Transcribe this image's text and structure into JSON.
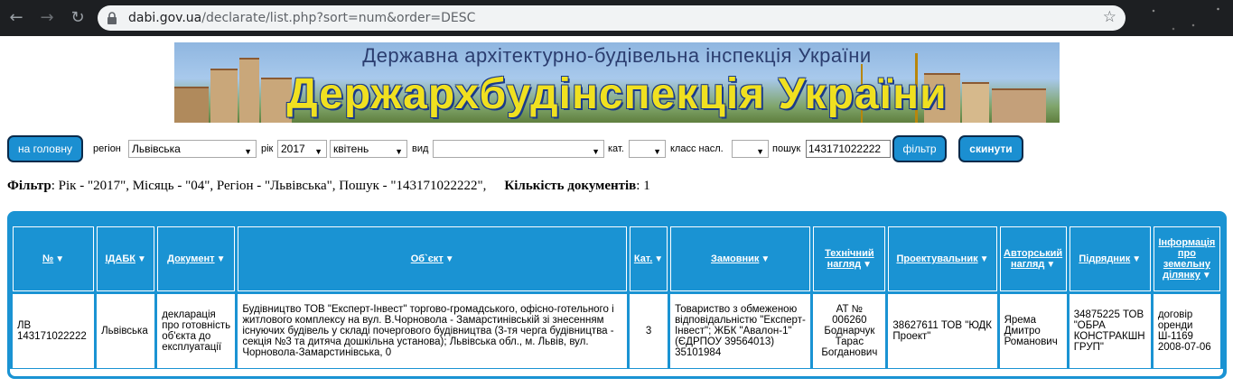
{
  "browser": {
    "url_host": "dabi.gov.ua",
    "url_path": "/declarate/list.php?sort=num&order=DESC",
    "back_glyph": "←",
    "forward_glyph": "→",
    "reload_glyph": "↻",
    "star_glyph": "☆"
  },
  "banner": {
    "subtitle": "Державна архітектурно-будівельна інспекція України",
    "title": "Держархбудінспекція України"
  },
  "filters": {
    "home_button": "на головну",
    "region_label": "регіон",
    "region_value": "Львівська",
    "year_label": "рік",
    "year_value": "2017",
    "month_value": "квітень",
    "type_label": "вид",
    "type_value": "",
    "cat_label": "кат.",
    "cat_value": "",
    "class_label": "класс насл.",
    "class_value": "",
    "search_label": "пошук",
    "search_value": "143171022222",
    "filter_button": "фільтр",
    "reset_button": "скинути",
    "dropdown_arrow": "▼"
  },
  "summary": {
    "filter_label": "Фільтр",
    "filter_text": ": Рік - \"2017\", Місяць - \"04\", Регіон - \"Львівська\", Пошук - \"143171022222\",",
    "count_label": "Кількість документів",
    "count_value": ": 1"
  },
  "table": {
    "sort_glyph": "▼",
    "headers": [
      "№",
      "ІДАБК",
      "Документ",
      "Об`єкт",
      "Кат.",
      "Замовник",
      "Технічний нагляд",
      "Проектувальник",
      "Авторський нагляд",
      "Підрядник",
      "Інформація про земельну ділянку"
    ],
    "row": {
      "num": "ЛВ 143171022222",
      "idabk": "Львівська",
      "document": "декларація про готовність об'єкта до експлуатації",
      "object": "Будівництво ТОВ \"Експерт-Інвест\" торгово-громадського, офісно-готельного і житлового комплексу на вул. В.Чорновола - Замарстинівській зі знесенням існуючих будівель у складі почергового будівництва (3-тя черга будівництва - секція №3 та дитяча дошкільна установа); Львівська обл., м. Львів, вул. Чорновола-Замарстинівська, 0",
      "cat": "3",
      "customer": "Товариство з обмеженою відповідальністю \"Експерт-Інвест\"; ЖБК \"Авалон-1\"(ЄДРПОУ 39564013) 35101984",
      "tech_supervision": "АТ № 006260 Боднарчук Тарас Богданович",
      "designer": "38627611 ТОВ \"ЮДК Проект\"",
      "author_supervision": "Ярема Дмитро Романович",
      "contractor": "34875225 ТОВ \"ОБРА КОНСТРАКШН ГРУП\"",
      "land_info": "договір оренди Ш-1169 2008-07-06"
    }
  }
}
